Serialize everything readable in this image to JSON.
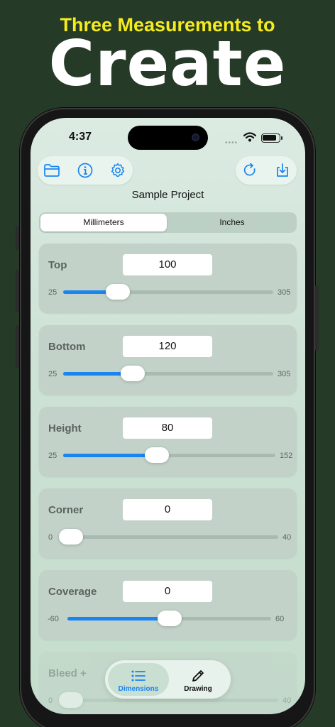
{
  "promo": {
    "line1": "Three Measurements to",
    "line2": "Create"
  },
  "status": {
    "time": "4:37",
    "dots": "••••"
  },
  "toolbar": {
    "left_icons": [
      "folder-icon",
      "info-icon",
      "gear-icon"
    ],
    "right_icons": [
      "refresh-icon",
      "download-icon"
    ]
  },
  "project": {
    "title": "Sample Project"
  },
  "units": {
    "options": [
      "Millimeters",
      "Inches"
    ],
    "selected": "Millimeters"
  },
  "dimensions": [
    {
      "label": "Top",
      "value": "100",
      "min": "25",
      "max": "305",
      "fraction": 0.26
    },
    {
      "label": "Bottom",
      "value": "120",
      "min": "25",
      "max": "305",
      "fraction": 0.33
    },
    {
      "label": "Height",
      "value": "80",
      "min": "25",
      "max": "152",
      "fraction": 0.44
    },
    {
      "label": "Corner",
      "value": "0",
      "min": "0",
      "max": "40",
      "fraction": 0.0
    },
    {
      "label": "Coverage",
      "value": "0",
      "min": "-60",
      "max": "60",
      "fraction": 0.5
    },
    {
      "label": "Bleed +",
      "value": "",
      "min": "0",
      "max": "40",
      "fraction": 0.0
    }
  ],
  "tabs": [
    {
      "label": "Dimensions",
      "icon": "list-icon",
      "active": true
    },
    {
      "label": "Drawing",
      "icon": "pencil-icon",
      "active": false
    }
  ],
  "colors": {
    "background": "#253a27",
    "headline_yellow": "#f5ec1e",
    "accent_blue": "#1a84f1"
  }
}
